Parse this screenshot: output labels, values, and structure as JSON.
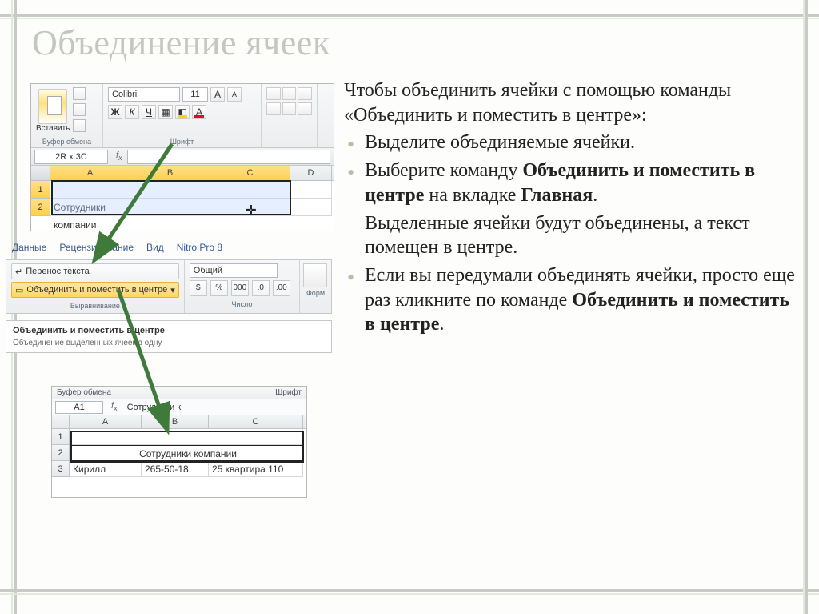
{
  "slide": {
    "title": "Объединение ячеек"
  },
  "text": {
    "p1": "Чтобы объединить ячейки с помощью команды «Объединить и поместить в центре»:",
    "b1": "Выделите объединяемые ячейки.",
    "b2a": "Выберите команду ",
    "b2b": "Объединить и поместить в центре",
    "b2c": " на вкладке ",
    "b2d": "Главная",
    "b2e": ".",
    "p3": "Выделенные ячейки будут объединены, а текст помещен в центре.",
    "b4a": "Если вы передумали объединять ячейки, просто еще раз кликните по команде ",
    "b4b": "Объединить и поместить в центре",
    "b4c": "."
  },
  "shot1": {
    "clipboard_label": "Буфер обмена",
    "paste_label": "Вставить",
    "font_label": "Шрифт",
    "font_name": "Colibri",
    "font_size": "11",
    "name_box": "2R x 3C",
    "cols": [
      "A",
      "B",
      "C",
      "D"
    ],
    "rows": [
      "1",
      "2"
    ],
    "row2_a": "Сотрудники компании"
  },
  "shot2": {
    "tabs": [
      "Данные",
      "Рецензирование",
      "Вид",
      "Nitro Pro 8"
    ],
    "wrap_label": "Перенос текста",
    "merge_label": "Объединить и поместить в центре",
    "align_group": "Выравнивание",
    "num_group": "Число",
    "num_format": "Общий",
    "pct": "%",
    "thousands": "000",
    "form_label": "Форм",
    "tooltip_title": "Объединить и поместить в центре",
    "tooltip_sub": "Объединение выделенных ячеек в одну"
  },
  "shot3": {
    "left_caption": "Буфер обмена",
    "right_caption": "Шрифт",
    "name_box": "A1",
    "formula_value": "Сотрудники к",
    "cols": [
      "A",
      "B",
      "C"
    ],
    "rows": [
      "1",
      "2",
      "3"
    ],
    "merged_text": "Сотрудники компании",
    "r3": {
      "a": "Кирилл",
      "b": "265-50-18",
      "c": "25 квартира 110"
    }
  }
}
